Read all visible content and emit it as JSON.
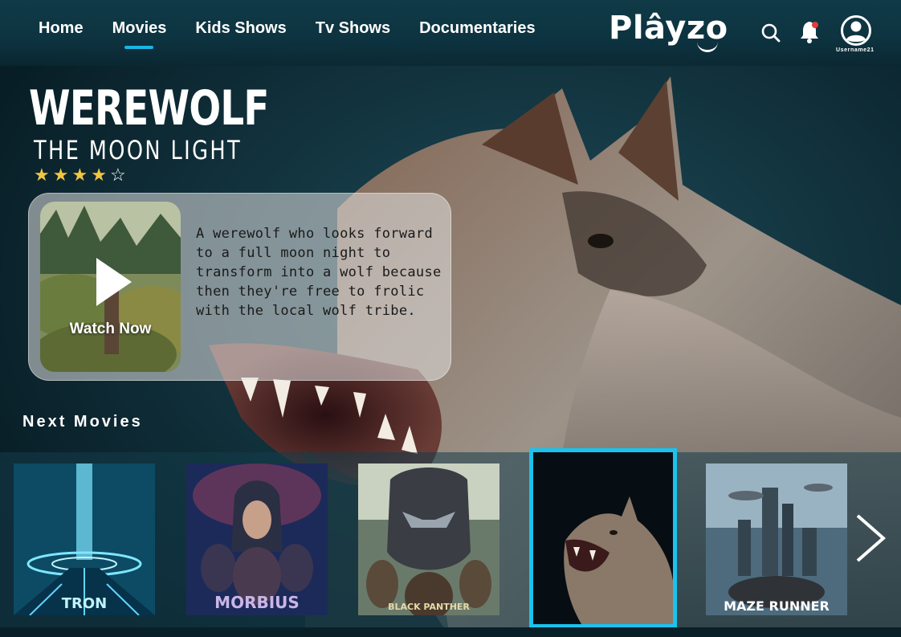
{
  "nav": {
    "items": [
      {
        "label": "Home",
        "active": false
      },
      {
        "label": "Movies",
        "active": true
      },
      {
        "label": "Kids Shows",
        "active": false
      },
      {
        "label": "Tv Shows",
        "active": false
      },
      {
        "label": "Documentaries",
        "active": false
      }
    ]
  },
  "brand": {
    "logo_text": "Plâyzo"
  },
  "header": {
    "icons": [
      "search-icon",
      "bell-icon",
      "user-icon"
    ],
    "notification_dot_color": "#e23b3b",
    "username": "Username21"
  },
  "featured": {
    "title": "WEREWOLF",
    "subtitle": "THE MOON LIGHT",
    "rating": 4,
    "rating_max": 5,
    "watch_label": "Watch Now",
    "description": "A werewolf who looks forward to a full moon night to transform into a wolf because then they're free to frolic with the local wolf tribe."
  },
  "next_movies": {
    "title": "Next Movies",
    "items": [
      {
        "title": "TRON"
      },
      {
        "title": "MORBIUS"
      },
      {
        "title": "BLACK PANTHER"
      },
      {
        "title": "",
        "selected": true
      },
      {
        "title": "MAZE RUNNER"
      }
    ]
  },
  "colors": {
    "accent": "#19c3ee",
    "star": "#f1c640",
    "topbar": "#0d3340"
  }
}
